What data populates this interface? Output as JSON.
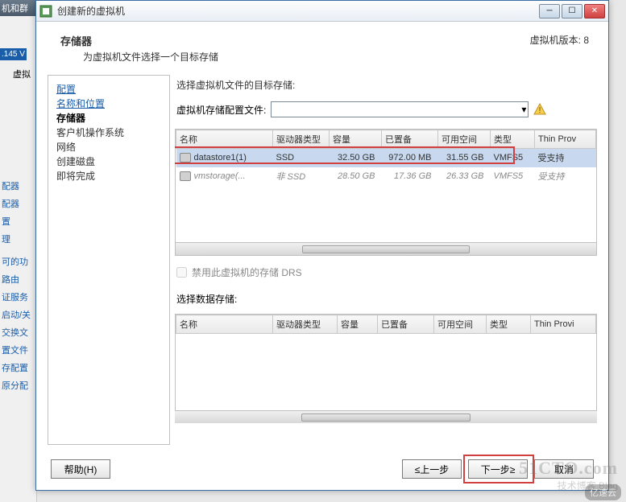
{
  "bg": {
    "toolbar": "机和群集",
    "ip_fragment": ".145 V",
    "tab": "虚拟",
    "side_items": [
      "配器",
      "配器",
      "置",
      "理",
      "",
      "可的功",
      "路由",
      "证服务",
      "启动/关",
      "交换文",
      "置文件",
      "存配置",
      "原分配"
    ]
  },
  "window": {
    "title": "创建新的虚拟机",
    "version_label": "虚拟机版本: 8",
    "header_title": "存储器",
    "header_sub": "为虚拟机文件选择一个目标存储"
  },
  "sidebar": {
    "items": [
      {
        "label": "配置",
        "cls": "link"
      },
      {
        "label": "名称和位置",
        "cls": "link"
      },
      {
        "label": "存储器",
        "cls": "current"
      },
      {
        "label": "客户机操作系统",
        "cls": ""
      },
      {
        "label": "网络",
        "cls": ""
      },
      {
        "label": "创建磁盘",
        "cls": ""
      },
      {
        "label": "即将完成",
        "cls": ""
      }
    ]
  },
  "content": {
    "prompt": "选择虚拟机文件的目标存储:",
    "config_label": "虚拟机存储配置文件:",
    "config_value": "",
    "drs_label": "禁用此虚拟机的存储 DRS",
    "select_label": "选择数据存储:"
  },
  "table1": {
    "headers": [
      "名称",
      "驱动器类型",
      "容量",
      "已置备",
      "可用空间",
      "类型",
      "Thin Prov"
    ],
    "rows": [
      {
        "name": "datastore1(1)",
        "drive": "SSD",
        "cap": "32.50 GB",
        "prov": "972.00 MB",
        "free": "31.55 GB",
        "type": "VMFS5",
        "thin": "受支持",
        "selected": true
      },
      {
        "name": "vmstorage(...",
        "drive": "非 SSD",
        "cap": "28.50 GB",
        "prov": "17.36 GB",
        "free": "26.33 GB",
        "type": "VMFS5",
        "thin": "受支持",
        "dim": true
      }
    ]
  },
  "table2": {
    "headers": [
      "名称",
      "驱动器类型",
      "容量",
      "已置备",
      "可用空间",
      "类型",
      "Thin Provi"
    ]
  },
  "footer": {
    "help": "帮助(H)",
    "back": "≤上一步",
    "next": "下一步≥",
    "cancel": "取消"
  },
  "watermark": {
    "line1": "51CTO.com",
    "line2": "技术博客 Blog",
    "yisu": "亿速云"
  }
}
